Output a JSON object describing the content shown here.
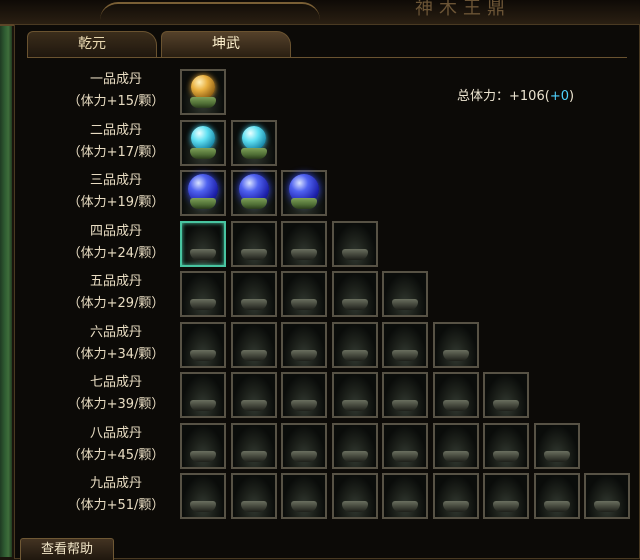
{
  "header": {
    "title": "神木王鼎"
  },
  "tabs": [
    {
      "label": "乾元",
      "active": false
    },
    {
      "label": "坤武",
      "active": true
    }
  ],
  "total": {
    "prefix": "总体力：",
    "value": "+106",
    "open": "(",
    "bonus": "+0",
    "close": ")"
  },
  "tiers": [
    {
      "name": "一品成丹",
      "bonus": "（体力+15/颗）",
      "slots": 1,
      "filled": 1,
      "orb": "gold"
    },
    {
      "name": "二品成丹",
      "bonus": "（体力+17/颗）",
      "slots": 2,
      "filled": 2,
      "orb": "cyan"
    },
    {
      "name": "三品成丹",
      "bonus": "（体力+19/颗）",
      "slots": 3,
      "filled": 3,
      "orb": "blue"
    },
    {
      "name": "四品成丹",
      "bonus": "（体力+24/颗）",
      "slots": 4,
      "filled": 0,
      "orb": "none",
      "selected_slot": 0
    },
    {
      "name": "五品成丹",
      "bonus": "（体力+29/颗）",
      "slots": 5,
      "filled": 0,
      "orb": "none"
    },
    {
      "name": "六品成丹",
      "bonus": "（体力+34/颗）",
      "slots": 6,
      "filled": 0,
      "orb": "none"
    },
    {
      "name": "七品成丹",
      "bonus": "（体力+39/颗）",
      "slots": 7,
      "filled": 0,
      "orb": "none"
    },
    {
      "name": "八品成丹",
      "bonus": "（体力+45/颗）",
      "slots": 8,
      "filled": 0,
      "orb": "none"
    },
    {
      "name": "九品成丹",
      "bonus": "（体力+51/颗）",
      "slots": 9,
      "filled": 0,
      "orb": "none"
    }
  ],
  "help_button": {
    "label": "查看帮助"
  },
  "colors": {
    "accent_bonus": "#4fd2ff",
    "selected_border": "#48c4a0"
  }
}
